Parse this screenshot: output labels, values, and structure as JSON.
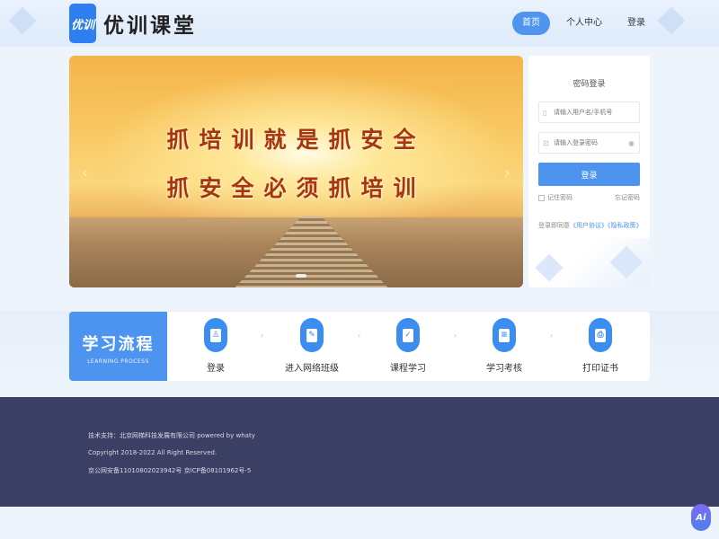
{
  "header": {
    "logo_badge": "优训",
    "logo_text": "优训课堂",
    "nav": [
      "首页",
      "个人中心",
      "登录"
    ],
    "active_nav": "首页"
  },
  "banner": {
    "line1": "抓培训就是抓安全",
    "line2": "抓安全必须抓培训"
  },
  "login": {
    "title": "密码登录",
    "username_placeholder": "请输入用户名/手机号",
    "password_placeholder": "请输入登录密码",
    "submit_label": "登录",
    "remember_label": "记住密码",
    "forgot_label": "忘记密码",
    "agree_prefix": "登录即同意",
    "user_agreement": "《用户协议》",
    "privacy_policy": "《隐私政策》"
  },
  "process": {
    "title": "学习流程",
    "subtitle": "LEARNING PROCESS",
    "steps": [
      {
        "label": "登录",
        "icon": "user-icon"
      },
      {
        "label": "进入网络班级",
        "icon": "class-icon"
      },
      {
        "label": "课程学习",
        "icon": "clipboard-icon"
      },
      {
        "label": "学习考核",
        "icon": "exam-icon"
      },
      {
        "label": "打印证书",
        "icon": "certificate-icon"
      }
    ]
  },
  "footer": {
    "support": "技术支持：北京网梯科技发展有限公司 powered by whaty",
    "copyright": "Copyright 2018-2022 All Right Reserved.",
    "icp": "京公网安备11010802023942号  京ICP备08101962号-5"
  },
  "assistant_label": "Ai"
}
